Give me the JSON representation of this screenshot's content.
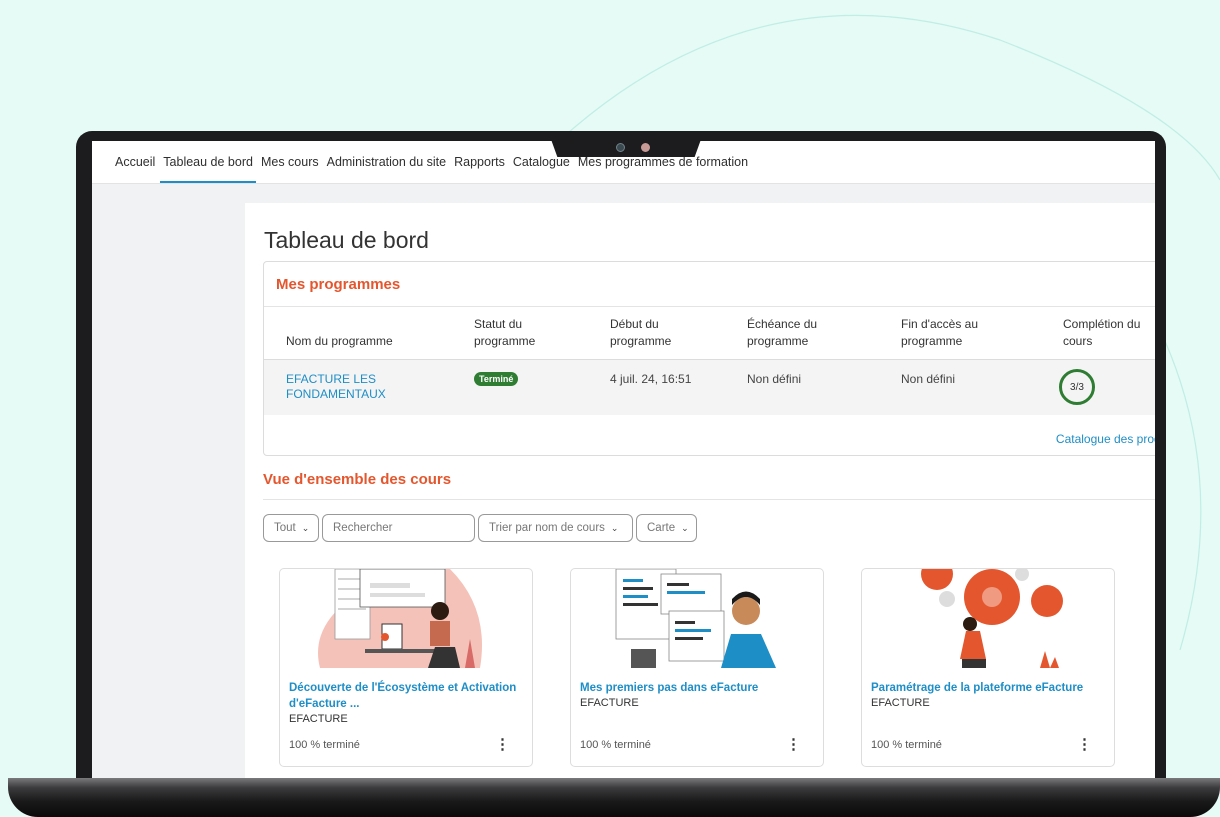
{
  "nav": {
    "items": [
      "Accueil",
      "Tableau de bord",
      "Mes cours",
      "Administration du site",
      "Rapports",
      "Catalogue",
      "Mes programmes de formation"
    ],
    "active_index": 1
  },
  "page": {
    "title": "Tableau de bord"
  },
  "programs": {
    "title": "Mes programmes",
    "headers": [
      "Nom du programme",
      "Statut du programme",
      "Début du programme",
      "Échéance du programme",
      "Fin d'accès au programme",
      "Complétion du cours"
    ],
    "row": {
      "name": "EFACTURE LES FONDAMENTAUX",
      "status": "Terminé",
      "start": "4 juil. 24, 16:51",
      "due": "Non défini",
      "end": "Non défini",
      "completion": "3/3"
    },
    "catalog_link": "Catalogue des programmes"
  },
  "overview": {
    "title": "Vue d'ensemble des cours",
    "filter": "Tout",
    "search_placeholder": "Rechercher",
    "sort": "Trier par nom de cours",
    "view": "Carte"
  },
  "courses": [
    {
      "name": "Découverte de l'Écosystème et Activation d'eFacture ...",
      "category": "EFACTURE",
      "progress": "100 % terminé"
    },
    {
      "name": "Mes premiers pas dans eFacture",
      "category": "EFACTURE",
      "progress": "100 % terminé"
    },
    {
      "name": "Paramétrage de la plateforme eFacture",
      "category": "EFACTURE",
      "progress": "100 % terminé"
    }
  ],
  "colors": {
    "accent_orange": "#e4572e",
    "link_blue": "#1e8ec7",
    "success_green": "#2e7d32",
    "background": "#e6faf6"
  },
  "icons": {
    "chevron": "chevron-down-icon",
    "menu": "kebab-menu-icon"
  }
}
